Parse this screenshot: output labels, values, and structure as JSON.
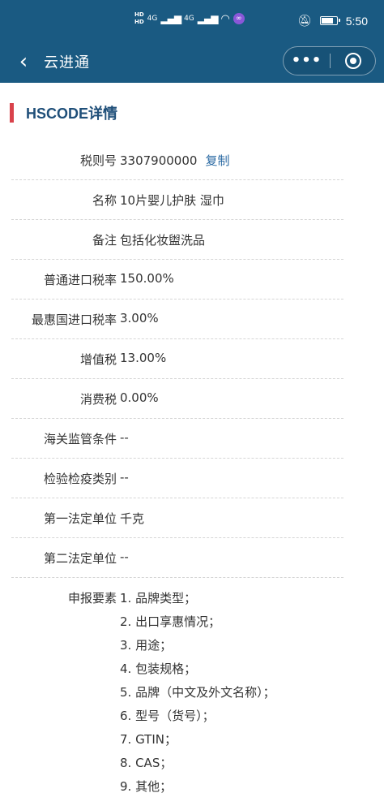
{
  "status_bar": {
    "hd1": "HD",
    "hd2": "HD",
    "net1": "4G",
    "net2": "4G",
    "time": "5:50",
    "battery_level": 0.85,
    "icons": [
      "hd-icon",
      "signal-icon",
      "wifi-icon",
      "app-badge-icon",
      "mute-bell-icon",
      "battery-icon"
    ]
  },
  "navbar": {
    "back_icon": "‹",
    "title": "云进通",
    "more_icon": "•••"
  },
  "section": {
    "title": "HSCODE详情"
  },
  "details": [
    {
      "label": "税则号",
      "value": "3307900000",
      "action": "复制"
    },
    {
      "label": "名称",
      "value": "10片婴儿护肤 湿巾"
    },
    {
      "label": "备注",
      "value": "包括化妆盥洗品"
    },
    {
      "label": "普通进口税率",
      "value": "150.00%"
    },
    {
      "label": "最惠国进口税率",
      "value": "3.00%"
    },
    {
      "label": "增值税",
      "value": "13.00%"
    },
    {
      "label": "消费税",
      "value": "0.00%"
    },
    {
      "label": "海关监管条件",
      "value": "--"
    },
    {
      "label": "检验检疫类别",
      "value": "--"
    },
    {
      "label": "第一法定单位",
      "value": "千克"
    },
    {
      "label": "第二法定单位",
      "value": "--"
    }
  ],
  "declaration": {
    "label": "申报要素",
    "items": [
      "1. 品牌类型；",
      "2. 出口享惠情况；",
      "3. 用途；",
      "4. 包装规格；",
      "5. 品牌（中文及外文名称）；",
      "6. 型号（货号）；",
      "7. GTIN；",
      "8. CAS；",
      "9. 其他；"
    ]
  }
}
